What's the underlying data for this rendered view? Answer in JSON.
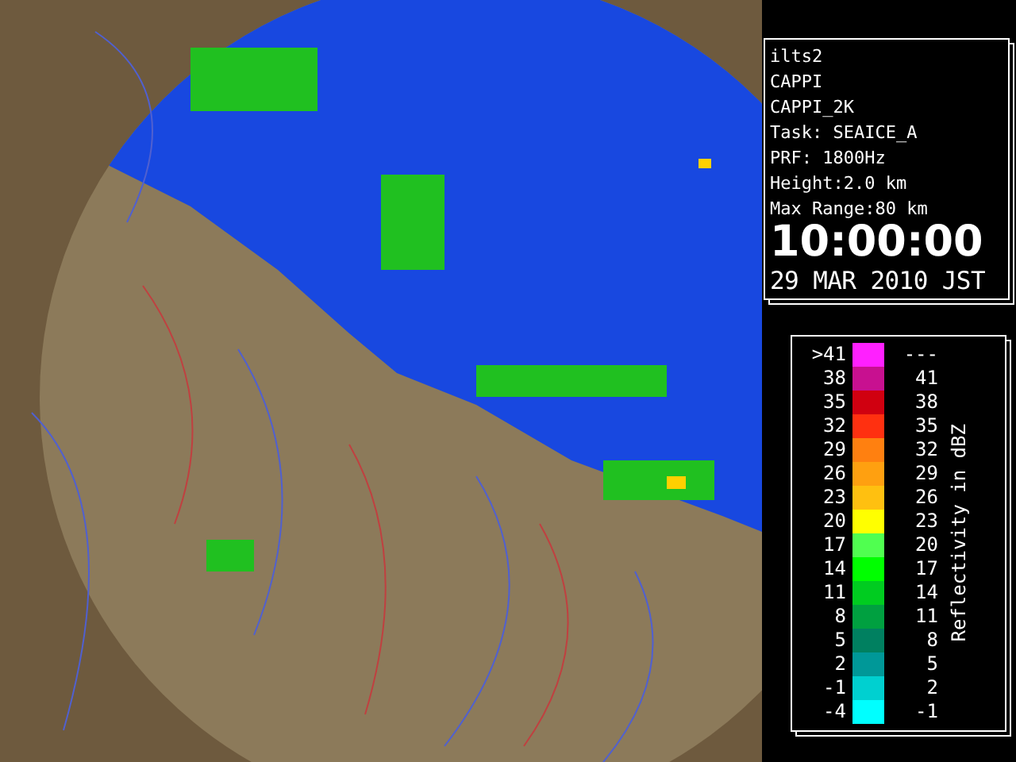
{
  "info_panel": {
    "lines": [
      "ilts2",
      "CAPPI",
      "CAPPI_2K",
      "Task: SEAICE_A",
      "PRF: 1800Hz",
      "Height:2.0 km",
      "Max Range:80 km"
    ],
    "time": "10:00:00",
    "date": "29 MAR 2010 JST"
  },
  "legend": {
    "title": "Reflectivity in dBZ",
    "rows": [
      {
        "low": ">41",
        "high": "---",
        "color": "#ff20ff"
      },
      {
        "low": "38",
        "high": "41",
        "color": "#c81090"
      },
      {
        "low": "35",
        "high": "38",
        "color": "#d00010"
      },
      {
        "low": "32",
        "high": "35",
        "color": "#ff3010"
      },
      {
        "low": "29",
        "high": "32",
        "color": "#ff8010"
      },
      {
        "low": "26",
        "high": "29",
        "color": "#ffa010"
      },
      {
        "low": "23",
        "high": "26",
        "color": "#ffc010"
      },
      {
        "low": "20",
        "high": "23",
        "color": "#ffff00"
      },
      {
        "low": "17",
        "high": "20",
        "color": "#50ff50"
      },
      {
        "low": "14",
        "high": "17",
        "color": "#00ff00"
      },
      {
        "low": "11",
        "high": "14",
        "color": "#00cc20"
      },
      {
        "low": "8",
        "high": "11",
        "color": "#00a040"
      },
      {
        "low": "5",
        "high": "8",
        "color": "#008060"
      },
      {
        "low": "2",
        "high": "5",
        "color": "#009898"
      },
      {
        "low": "-1",
        "high": "2",
        "color": "#00d0d0"
      },
      {
        "low": "-4",
        "high": "-1",
        "color": "#00ffff"
      }
    ]
  }
}
